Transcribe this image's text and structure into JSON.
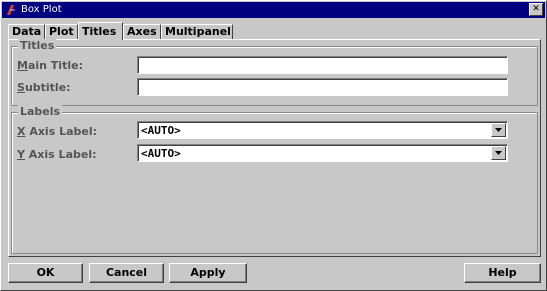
{
  "window": {
    "title": "Box Plot",
    "close_symbol": "✕"
  },
  "tabs": [
    {
      "label": "Data",
      "active": false
    },
    {
      "label": "Plot",
      "active": false
    },
    {
      "label": "Titles",
      "active": true
    },
    {
      "label": "Axes",
      "active": false
    },
    {
      "label": "Multipanel",
      "active": false
    }
  ],
  "titles_group": {
    "legend": "Titles",
    "main_title": {
      "mnemonic": "M",
      "rest": "ain Title:",
      "value": ""
    },
    "subtitle": {
      "mnemonic": "S",
      "rest": "ubtitle:",
      "value": ""
    }
  },
  "labels_group": {
    "legend": "Labels",
    "x_axis": {
      "mnemonic": "X",
      "rest": " Axis Label:",
      "value": "<AUTO>"
    },
    "y_axis": {
      "mnemonic": "Y",
      "rest": " Axis Label:",
      "value": "<AUTO>"
    }
  },
  "buttons": {
    "ok": "OK",
    "cancel": "Cancel",
    "apply": "Apply",
    "help": "Help"
  }
}
